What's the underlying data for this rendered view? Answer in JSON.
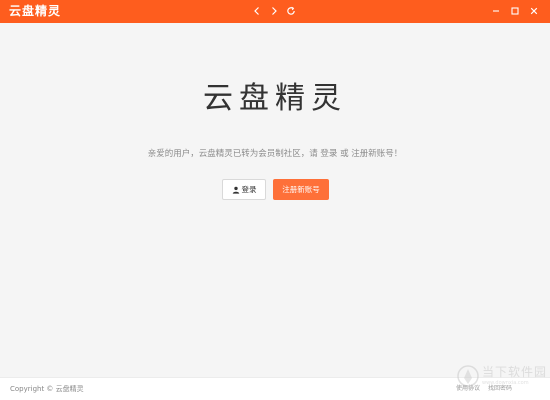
{
  "titlebar": {
    "app_title": "云盘精灵",
    "background_color": "#fe5d1e",
    "nav_icons": [
      "chevron-left-icon",
      "chevron-right-icon",
      "refresh-icon"
    ],
    "window_icons": [
      "minimize-icon",
      "maximize-icon",
      "close-icon"
    ]
  },
  "main": {
    "logo_text": "云盘精灵",
    "welcome_message": "亲爱的用户，云盘精灵已转为会员制社区，请 登录 或 注册新账号！",
    "login_button": {
      "label": "登录",
      "icon": "user-icon"
    },
    "register_button": {
      "label": "注册新账号",
      "color": "#fe7039"
    }
  },
  "footer": {
    "copyright": "Copyright © 云盘精灵",
    "links": [
      "使用协议",
      "找回密码"
    ]
  },
  "watermark": {
    "title": "当下软件园",
    "url": "www.downxia.com"
  }
}
